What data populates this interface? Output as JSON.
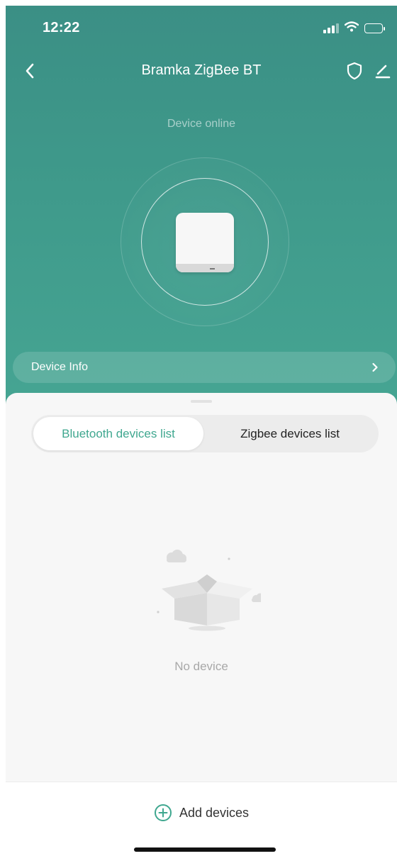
{
  "status_bar": {
    "time": "12:22"
  },
  "nav": {
    "title": "Bramka ZigBee BT"
  },
  "device": {
    "status": "Device online"
  },
  "info_row": {
    "label": "Device Info"
  },
  "tabs": [
    {
      "label": "Bluetooth devices list",
      "selected": true
    },
    {
      "label": "Zigbee devices list",
      "selected": false
    }
  ],
  "empty_state": {
    "text": "No device"
  },
  "footer": {
    "add_label": "Add devices"
  },
  "colors": {
    "accent": "#3fa78f",
    "hero_top": "#3b8f85",
    "hero_bottom": "#46a593"
  },
  "icons": {
    "back": "chevron-left-icon",
    "shield": "shield-icon",
    "edit": "pencil-icon",
    "info_arrow": "chevron-right-icon",
    "add": "plus-circle-icon",
    "empty": "open-box-icon"
  }
}
